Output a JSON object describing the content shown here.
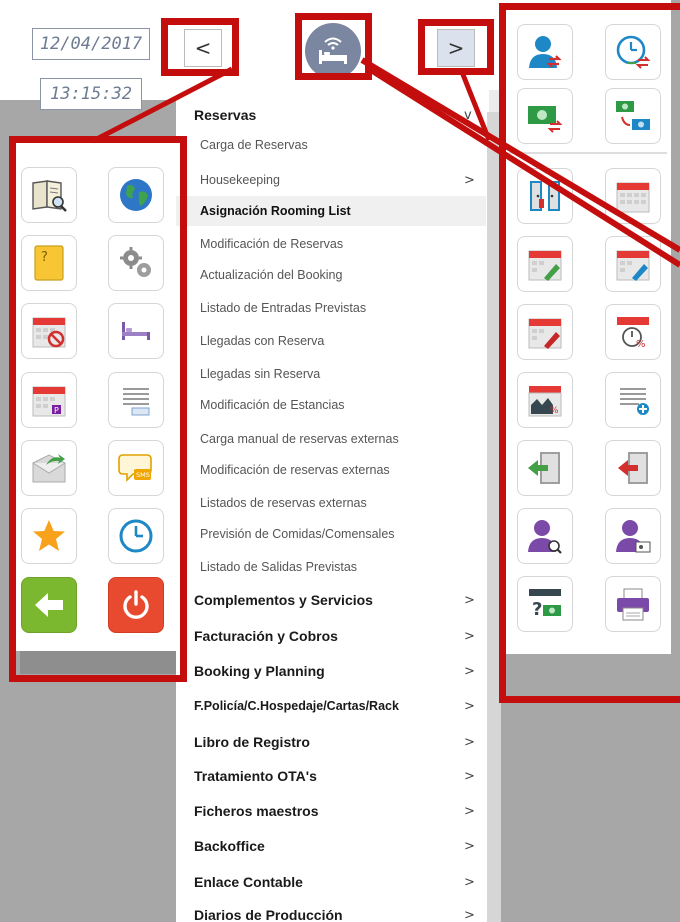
{
  "header": {
    "date": "12/04/2017",
    "time": "13:15:32",
    "back_glyph": "<",
    "forward_glyph": ">",
    "logo_icon": "hotel-bed-wifi-icon"
  },
  "left_icons": [
    {
      "name": "book-search-icon"
    },
    {
      "name": "globe-icon"
    },
    {
      "name": "help-folder-icon"
    },
    {
      "name": "gears-icon"
    },
    {
      "name": "calendar-cancel-icon"
    },
    {
      "name": "bed-icon"
    },
    {
      "name": "calendar-p-icon"
    },
    {
      "name": "list-document-icon"
    },
    {
      "name": "envelope-forward-icon"
    },
    {
      "name": "sms-bubble-icon"
    },
    {
      "name": "star-icon"
    },
    {
      "name": "clock-icon"
    },
    {
      "name": "exit-arrow-icon"
    },
    {
      "name": "power-icon"
    }
  ],
  "right_icons": [
    {
      "name": "user-transfer-icon"
    },
    {
      "name": "clock-transfer-icon"
    },
    {
      "name": "money-transfer-icon"
    },
    {
      "name": "money-exchange-icon"
    },
    {
      "name": "room-doors-icon"
    },
    {
      "name": "calendar-grid-icon"
    },
    {
      "name": "calendar-green-check-icon"
    },
    {
      "name": "calendar-blue-pen-icon"
    },
    {
      "name": "calendar-red-pen-icon"
    },
    {
      "name": "calendar-percent-clock-icon"
    },
    {
      "name": "calendar-chart-percent-icon"
    },
    {
      "name": "list-add-icon"
    },
    {
      "name": "door-enter-icon"
    },
    {
      "name": "door-exit-icon"
    },
    {
      "name": "user-search-purple-icon"
    },
    {
      "name": "user-card-purple-icon"
    },
    {
      "name": "calendar-money-question-icon"
    },
    {
      "name": "printer-icon"
    }
  ],
  "menu": {
    "section_open": "Reservas",
    "section_open_chevron": "v",
    "subitems": [
      "Carga de Reservas",
      "Housekeeping",
      "Asignación Rooming List",
      "Modificación de Reservas",
      "Actualización del Booking",
      "Listado de Entradas Previstas",
      "Llegadas con Reserva",
      "Llegadas sin Reserva",
      "Modificación de Estancias",
      "Carga manual de reservas externas",
      "Modificación de reservas externas",
      "Listados de reservas externas",
      "Previsión de Comidas/Comensales",
      "Listado de Salidas Previstas"
    ],
    "active_subitem": "Asignación Rooming List",
    "housekeeping_chevron": ">",
    "sections": [
      "Complementos y Servicios",
      "Facturación y Cobros",
      "Booking y Planning",
      "F.Policía/C.Hospedaje/Cartas/Rack",
      "Libro de Registro",
      "Tratamiento OTA's",
      "Ficheros maestros",
      "Backoffice",
      "Enlace Contable",
      "Diarios de Producción"
    ],
    "chevron": ">"
  },
  "colors": {
    "annotation_red": "#c40d0d",
    "background": "#9a9a9a"
  }
}
